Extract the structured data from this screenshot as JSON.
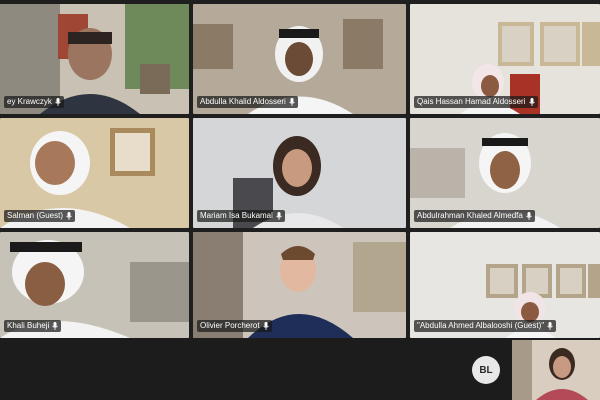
{
  "participants": [
    {
      "name": "ey Krawczyk"
    },
    {
      "name": "Abdulla Khalid Aldosseri"
    },
    {
      "name": "Qais Hassan Hamad Aldosseri"
    },
    {
      "name": "Salman (Guest)"
    },
    {
      "name": "Mariam Isa Bukamal"
    },
    {
      "name": "Abdulrahman Khaled Almedfa"
    },
    {
      "name": "Khali Buheji"
    },
    {
      "name": "Olivier Porcherot"
    },
    {
      "name": "\"Abdulla Ahmed Albalooshi (Guest)\""
    }
  ],
  "self_avatar": {
    "initials": "BL"
  },
  "icons": {
    "mic": "microphone-muted-icon"
  },
  "colors": {
    "label_bg": "#191919",
    "bar_bg": "#1c1c1c"
  }
}
